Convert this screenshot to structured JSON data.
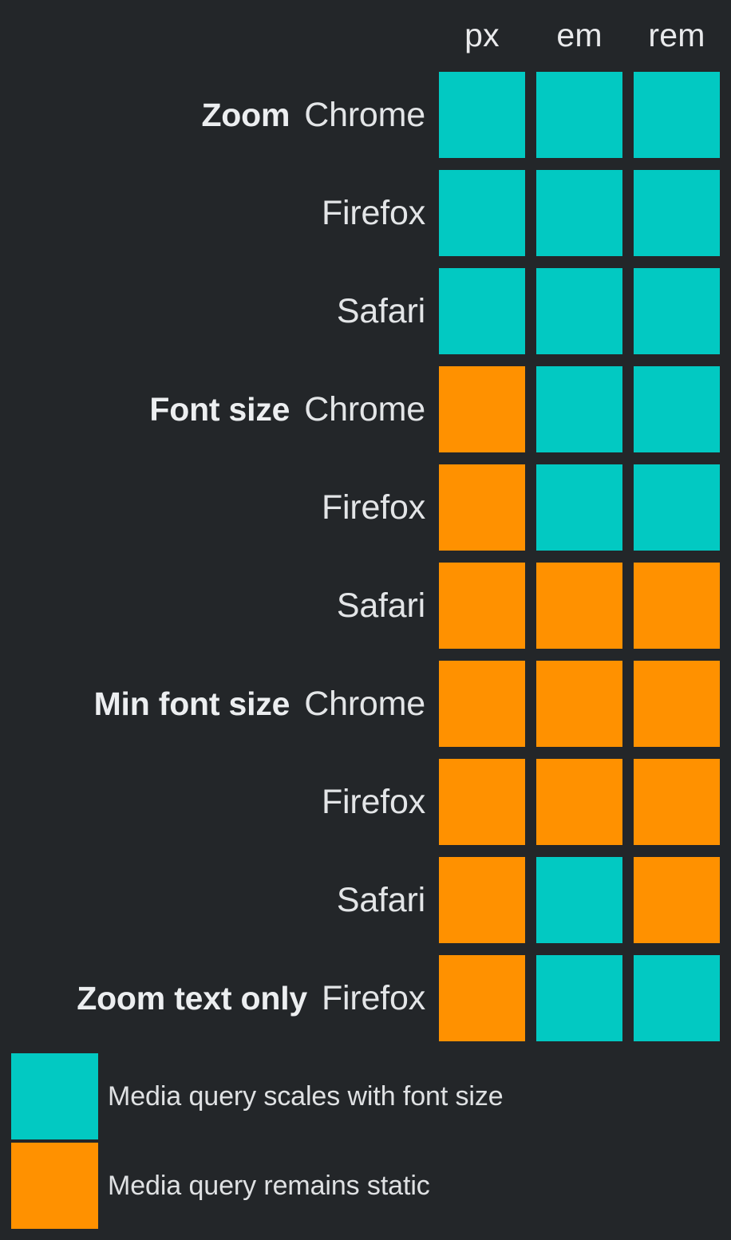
{
  "colors": {
    "background": "#232629",
    "scales": "#02c9c2",
    "static": "#ff9100",
    "text": "#e9eaec"
  },
  "chart_data": {
    "type": "heatmap",
    "title": "",
    "xlabel": "",
    "ylabel": "",
    "grid": false,
    "legend_position": "bottom-left",
    "columns": [
      "px",
      "em",
      "rem"
    ],
    "row_groups": [
      "Zoom",
      "Font size",
      "Min font size",
      "Zoom text only"
    ],
    "value_labels": {
      "scales": "Media query scales with font size",
      "static": "Media query remains static"
    },
    "rows": [
      {
        "group": "Zoom",
        "browser": "Chrome",
        "values": [
          "scales",
          "scales",
          "scales"
        ]
      },
      {
        "group": "",
        "browser": "Firefox",
        "values": [
          "scales",
          "scales",
          "scales"
        ]
      },
      {
        "group": "",
        "browser": "Safari",
        "values": [
          "scales",
          "scales",
          "scales"
        ]
      },
      {
        "group": "Font size",
        "browser": "Chrome",
        "values": [
          "static",
          "scales",
          "scales"
        ]
      },
      {
        "group": "",
        "browser": "Firefox",
        "values": [
          "static",
          "scales",
          "scales"
        ]
      },
      {
        "group": "",
        "browser": "Safari",
        "values": [
          "static",
          "static",
          "static"
        ]
      },
      {
        "group": "Min font size",
        "browser": "Chrome",
        "values": [
          "static",
          "static",
          "static"
        ]
      },
      {
        "group": "",
        "browser": "Firefox",
        "values": [
          "static",
          "static",
          "static"
        ]
      },
      {
        "group": "",
        "browser": "Safari",
        "values": [
          "static",
          "scales",
          "static"
        ]
      },
      {
        "group": "Zoom text only",
        "browser": "Firefox",
        "values": [
          "static",
          "scales",
          "scales"
        ]
      }
    ],
    "legend": [
      {
        "key": "scales",
        "label": "Media query scales with font size",
        "color": "#02c9c2"
      },
      {
        "key": "static",
        "label": "Media query remains static",
        "color": "#ff9100"
      }
    ]
  }
}
